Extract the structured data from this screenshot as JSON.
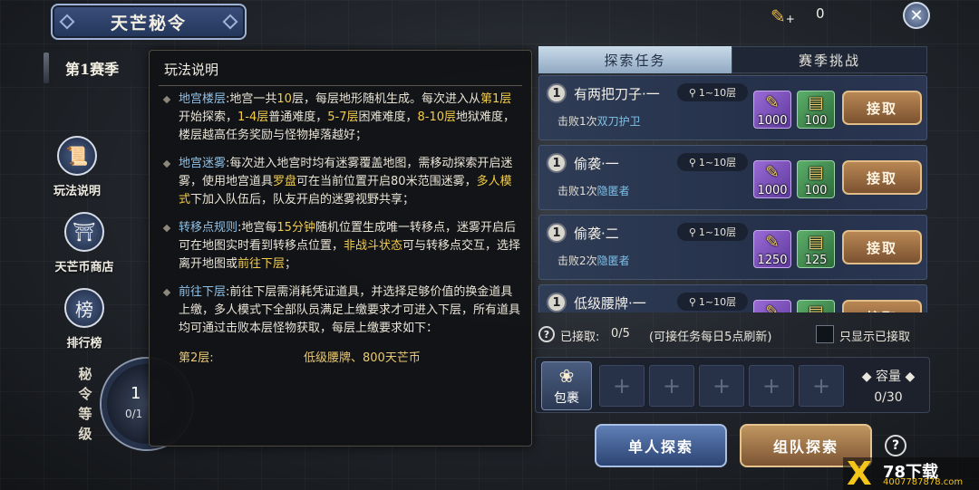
{
  "header": {
    "title": "天芒秘令",
    "currency_value": "0"
  },
  "sidebar": {
    "season": "第1赛季",
    "buttons": [
      {
        "label": "玩法说明",
        "icon": "scroll-icon"
      },
      {
        "label": "天芒币商店",
        "icon": "shop-icon"
      },
      {
        "label": "排行榜",
        "icon": "rank-icon"
      }
    ],
    "vertical_label": [
      "秘",
      "令",
      "等",
      "级"
    ],
    "ring_text": [
      "1",
      "0/1"
    ]
  },
  "rules": {
    "title": "玩法说明",
    "p1": {
      "k": "地宫楼层",
      "a": ":地宫一共",
      "n10": "10",
      "b": "层，每层地形随机生成。每次进入从",
      "f1": "第1层",
      "c": "开始探索，",
      "f14": "1-4层",
      "d": "普通难度，",
      "f57": "5-7层",
      "e": "困难难度，",
      "f810": "8-10层",
      "f": "地狱难度，楼层越高任务奖励与怪物掉落越好；"
    },
    "p2": {
      "k": "地宫迷雾",
      "a": ":每次进入地宫时均有迷雾覆盖地图，需移动探索开启迷雾，使用地宫道具",
      "y1": "罗盘",
      "b": "可在当前位置开启80米范围迷雾，",
      "y2": "多人模式",
      "c": "下加入队伍后，队友开启的迷雾视野共享；"
    },
    "p3": {
      "k": "转移点规则",
      "a": ":地宫每",
      "y1": "15分钟",
      "b": "随机位置生成唯一转移点，迷雾开启后可在地图实时看到转移点位置，",
      "y2": "非战斗状态",
      "c": "可与转移点交互，选择离开地图或",
      "y3": "前往下层",
      "d": "；"
    },
    "p4": {
      "k": "前往下层",
      "a": ":前往下层需消耗凭证道具，并选择足够价值的换金道具上缴，多人模式下全部队员满足上缴要求才可进入下层，所有道具均可通过击败本层怪物获取，每层上缴要求如下："
    },
    "floor_row": {
      "left": "第2层:",
      "right": "低级腰牌、800天芒币"
    }
  },
  "tabs": {
    "active": "探索任务",
    "inactive": "赛季挑战"
  },
  "quests": [
    {
      "num": "1",
      "name": "有两把刀子·一",
      "level": "1~10层",
      "desc_a": "击败1次",
      "desc_b": "双刀护卫",
      "r1": "1000",
      "r2": "100",
      "claim": "接取"
    },
    {
      "num": "1",
      "name": "偷袭·一",
      "level": "1~10层",
      "desc_a": "击败1次",
      "desc_b": "隐匿者",
      "r1": "1000",
      "r2": "100",
      "claim": "接取"
    },
    {
      "num": "1",
      "name": "偷袭·二",
      "level": "1~10层",
      "desc_a": "击败2次",
      "desc_b": "隐匿者",
      "r1": "1250",
      "r2": "125",
      "claim": "接取"
    },
    {
      "num": "1",
      "name": "低级腰牌·一",
      "level": "1~10层",
      "desc_a": "",
      "desc_b": "",
      "r1": "",
      "r2": "",
      "claim": "接取"
    }
  ],
  "status": {
    "accepted_label": "已接取:",
    "accepted_value": "0/5",
    "refresh_note": "(可接任务每日5点刷新)",
    "only_show_label": "只显示已接取"
  },
  "bag": {
    "label": "包裹",
    "capacity_label": "容量",
    "capacity_value": "0/30"
  },
  "buttons": {
    "solo": "单人探索",
    "team": "组队探索"
  },
  "watermark": {
    "brand": "78下载",
    "url": "4007787878.com"
  },
  "colors": {
    "highlight_yellow": "#f2cc4a",
    "keyword_blue": "#8fc0e6",
    "tab_active": "#b7cde0",
    "claim_gold": "#a9784a"
  }
}
